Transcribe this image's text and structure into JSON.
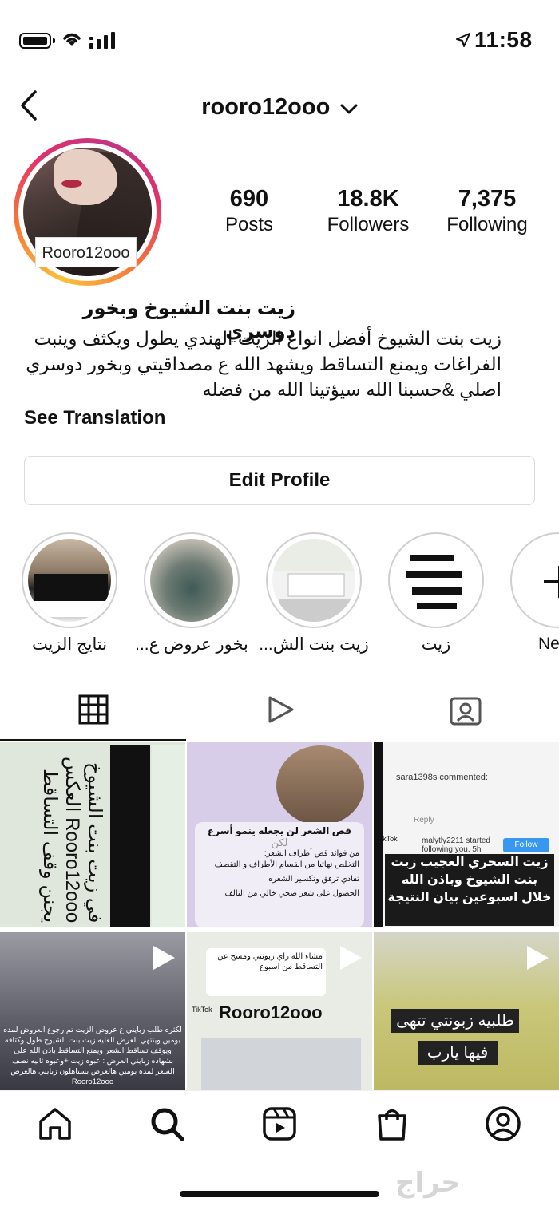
{
  "status_bar": {
    "time": "11:58",
    "icons": [
      "battery-icon",
      "wifi-icon",
      "signal-icon",
      "location-arrow-icon"
    ]
  },
  "header": {
    "username": "rooro12ooo",
    "back_icon": "chevron-left-icon",
    "dropdown_icon": "chevron-down-icon"
  },
  "avatar": {
    "label": "Rooro12ooo"
  },
  "stats": [
    {
      "value": "690",
      "label": "Posts"
    },
    {
      "value": "18.8K",
      "label": "Followers"
    },
    {
      "value": "7,375",
      "label": "Following"
    }
  ],
  "bio": {
    "name": "زيت بنت الشيوخ وبخور دوسري",
    "text": "زيت بنت الشيوخ أفضل انواع الزيت الهندي يطول ويكثف وينبت الفراغات ويمنع التساقط ويشهد الله ع مصداقيتي وبخور دوسري اصلي &حسبنا الله سيؤتينا الله من فضله",
    "see_translation": "See Translation"
  },
  "edit_profile": "Edit Profile",
  "highlights": [
    {
      "label": "نتايج الزيت"
    },
    {
      "label": "بخور عروض ع..."
    },
    {
      "label": "زيت بنت الش..."
    },
    {
      "label": "زيت"
    },
    {
      "label": "Ne"
    }
  ],
  "tabs": [
    "grid-icon",
    "reels-icon",
    "tagged-icon"
  ],
  "posts": [
    {
      "text": "في زيت بنت الشيوخ Rooro12ooo العكس يجنن وقف التساقط"
    },
    {
      "title": "قص الشعر لن يجعله ينمو أسرع",
      "subtitle": "لكن",
      "intro": "من فوائد قص أطراف الشعر:",
      "bullets": [
        "التخلص نهائيا من انقسام الأطراف و التقصف",
        "تفادي ترقق وتكسير الشعره",
        "الحصول على شعر صحي خالي من التالف"
      ]
    },
    {
      "commenter": "sara1398s commented:",
      "follower": "malytly2211 started following you. 5h",
      "follow_label": "Follow",
      "caption": "زيت السحري العجيب زيت بنت الشيوخ وباذن الله خلال اسبوعين بيان النتيجة",
      "reply": "Reply",
      "tiktok": "TikTok"
    },
    {
      "text": "لكثره طلب زبايني ع عروض الزيت تم رجوع العروض لمده يومين وينتهي العرض العليه زيت بنت الشيوخ طول وكثافه ويوقف تساقط الشعر ويمنع التساقط باذن الله على بشهاده زبايني العرض : عبوه زيت +وعبوه ثانيه نصف السعر لمده يومين هالعرض يستاهلون زبايني هالعرض Rooro12ooo"
    },
    {
      "text": "مشاء الله راي زبونتي ومسح عن التساقط من اسبوع",
      "watermark": "Rooro12ooo",
      "tiktok": "TikTok"
    },
    {
      "line1": "طلبيه زبونتي تتهى",
      "line2": "فيها يارب"
    }
  ],
  "nav": [
    "home-icon",
    "search-icon",
    "reels-icon",
    "shop-icon",
    "profile-icon"
  ],
  "watermark": "حراج"
}
